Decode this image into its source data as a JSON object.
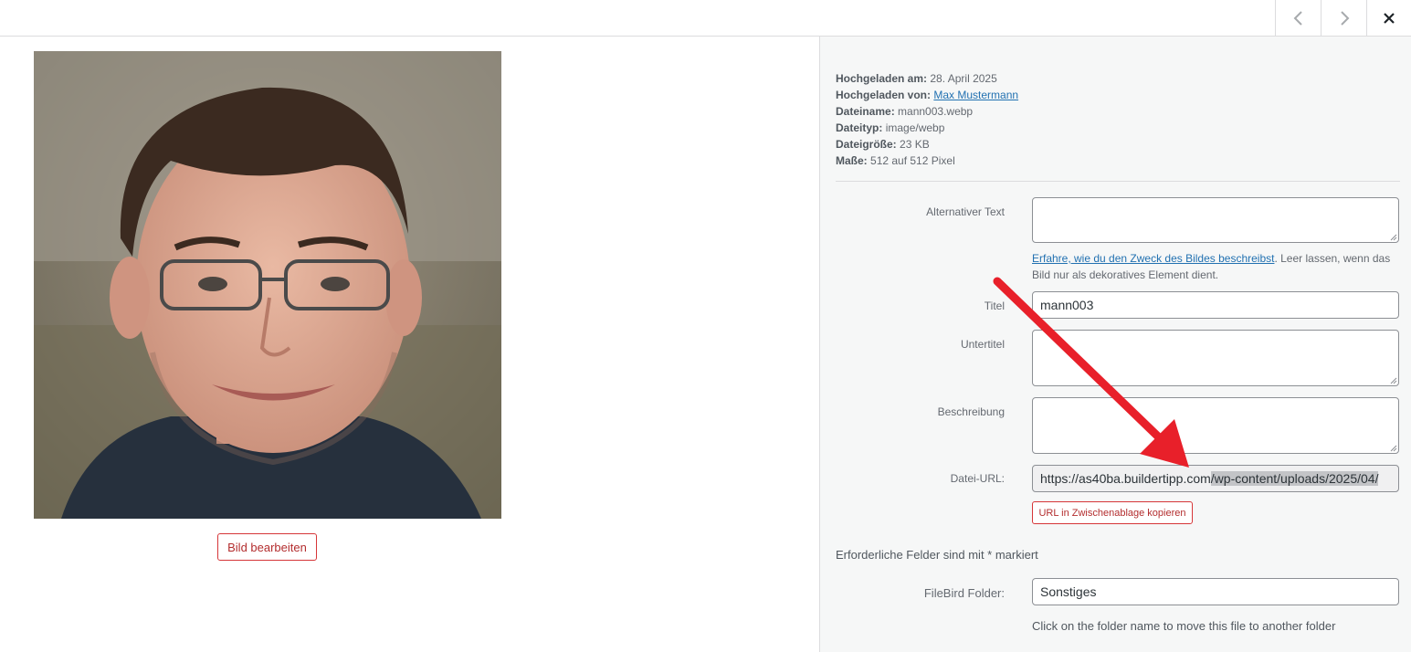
{
  "nav": {
    "prev_icon": "chevron-left-icon",
    "next_icon": "chevron-right-icon",
    "close_icon": "close-icon"
  },
  "image": {
    "edit_label": "Bild bearbeiten"
  },
  "details": {
    "uploaded_on_label": "Hochgeladen am:",
    "uploaded_on_value": "28. April 2025",
    "uploaded_by_label": "Hochgeladen von:",
    "uploaded_by_value": "Max Mustermann",
    "filename_label": "Dateiname:",
    "filename_value": "mann003.webp",
    "filetype_label": "Dateityp:",
    "filetype_value": "image/webp",
    "filesize_label": "Dateigröße:",
    "filesize_value": "23 KB",
    "dimensions_label": "Maße:",
    "dimensions_value": "512 auf 512 Pixel"
  },
  "form": {
    "alt_label": "Alternativer Text",
    "alt_value": "",
    "alt_help_link": "Erfahre, wie du den Zweck des Bildes beschreibst",
    "alt_help_text": ". Leer lassen, wenn das Bild nur als dekoratives Element dient.",
    "title_label": "Titel",
    "title_value": "mann003",
    "caption_label": "Untertitel",
    "caption_value": "",
    "description_label": "Beschreibung",
    "description_value": "",
    "url_label": "Datei-URL:",
    "url_value_start": "https://as40ba.buildertipp.com",
    "url_value_selected": "/wp-content/uploads/2025/04/",
    "copy_label": "URL in Zwischenablage kopieren",
    "required_note": "Erforderliche Felder sind mit * markiert",
    "filebird_label": "FileBird Folder:",
    "filebird_value": "Sonstiges",
    "filebird_hint": "Click on the folder name to move this file to another folder"
  },
  "colors": {
    "accent_link": "#2271b1",
    "danger": "#d63638",
    "annotation_arrow": "#e8202a"
  }
}
